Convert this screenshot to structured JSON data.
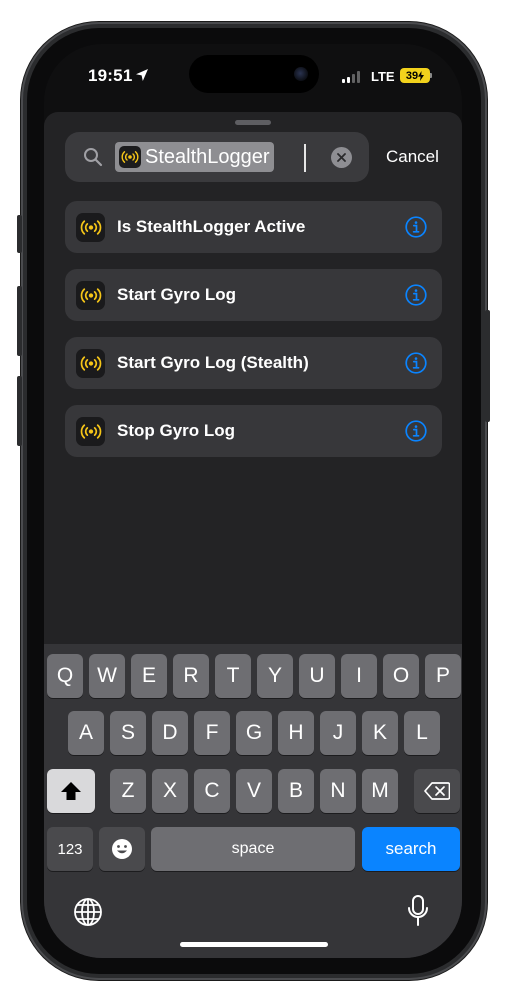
{
  "status": {
    "time": "19:51",
    "network": "LTE",
    "battery": "39"
  },
  "search": {
    "query": "StealthLogger",
    "cancel_label": "Cancel"
  },
  "results": [
    {
      "label": "Is StealthLogger Active"
    },
    {
      "label": "Start Gyro Log"
    },
    {
      "label": "Start Gyro Log (Stealth)"
    },
    {
      "label": "Stop Gyro Log"
    }
  ],
  "keyboard": {
    "row1": [
      "Q",
      "W",
      "E",
      "R",
      "T",
      "Y",
      "U",
      "I",
      "O",
      "P"
    ],
    "row2": [
      "A",
      "S",
      "D",
      "F",
      "G",
      "H",
      "J",
      "K",
      "L"
    ],
    "row3": [
      "Z",
      "X",
      "C",
      "V",
      "B",
      "N",
      "M"
    ],
    "numbers_label": "123",
    "space_label": "space",
    "search_label": "search"
  },
  "colors": {
    "accent": "#0a84ff",
    "app_icon": "#f5c518",
    "battery": "#f2d21c"
  }
}
